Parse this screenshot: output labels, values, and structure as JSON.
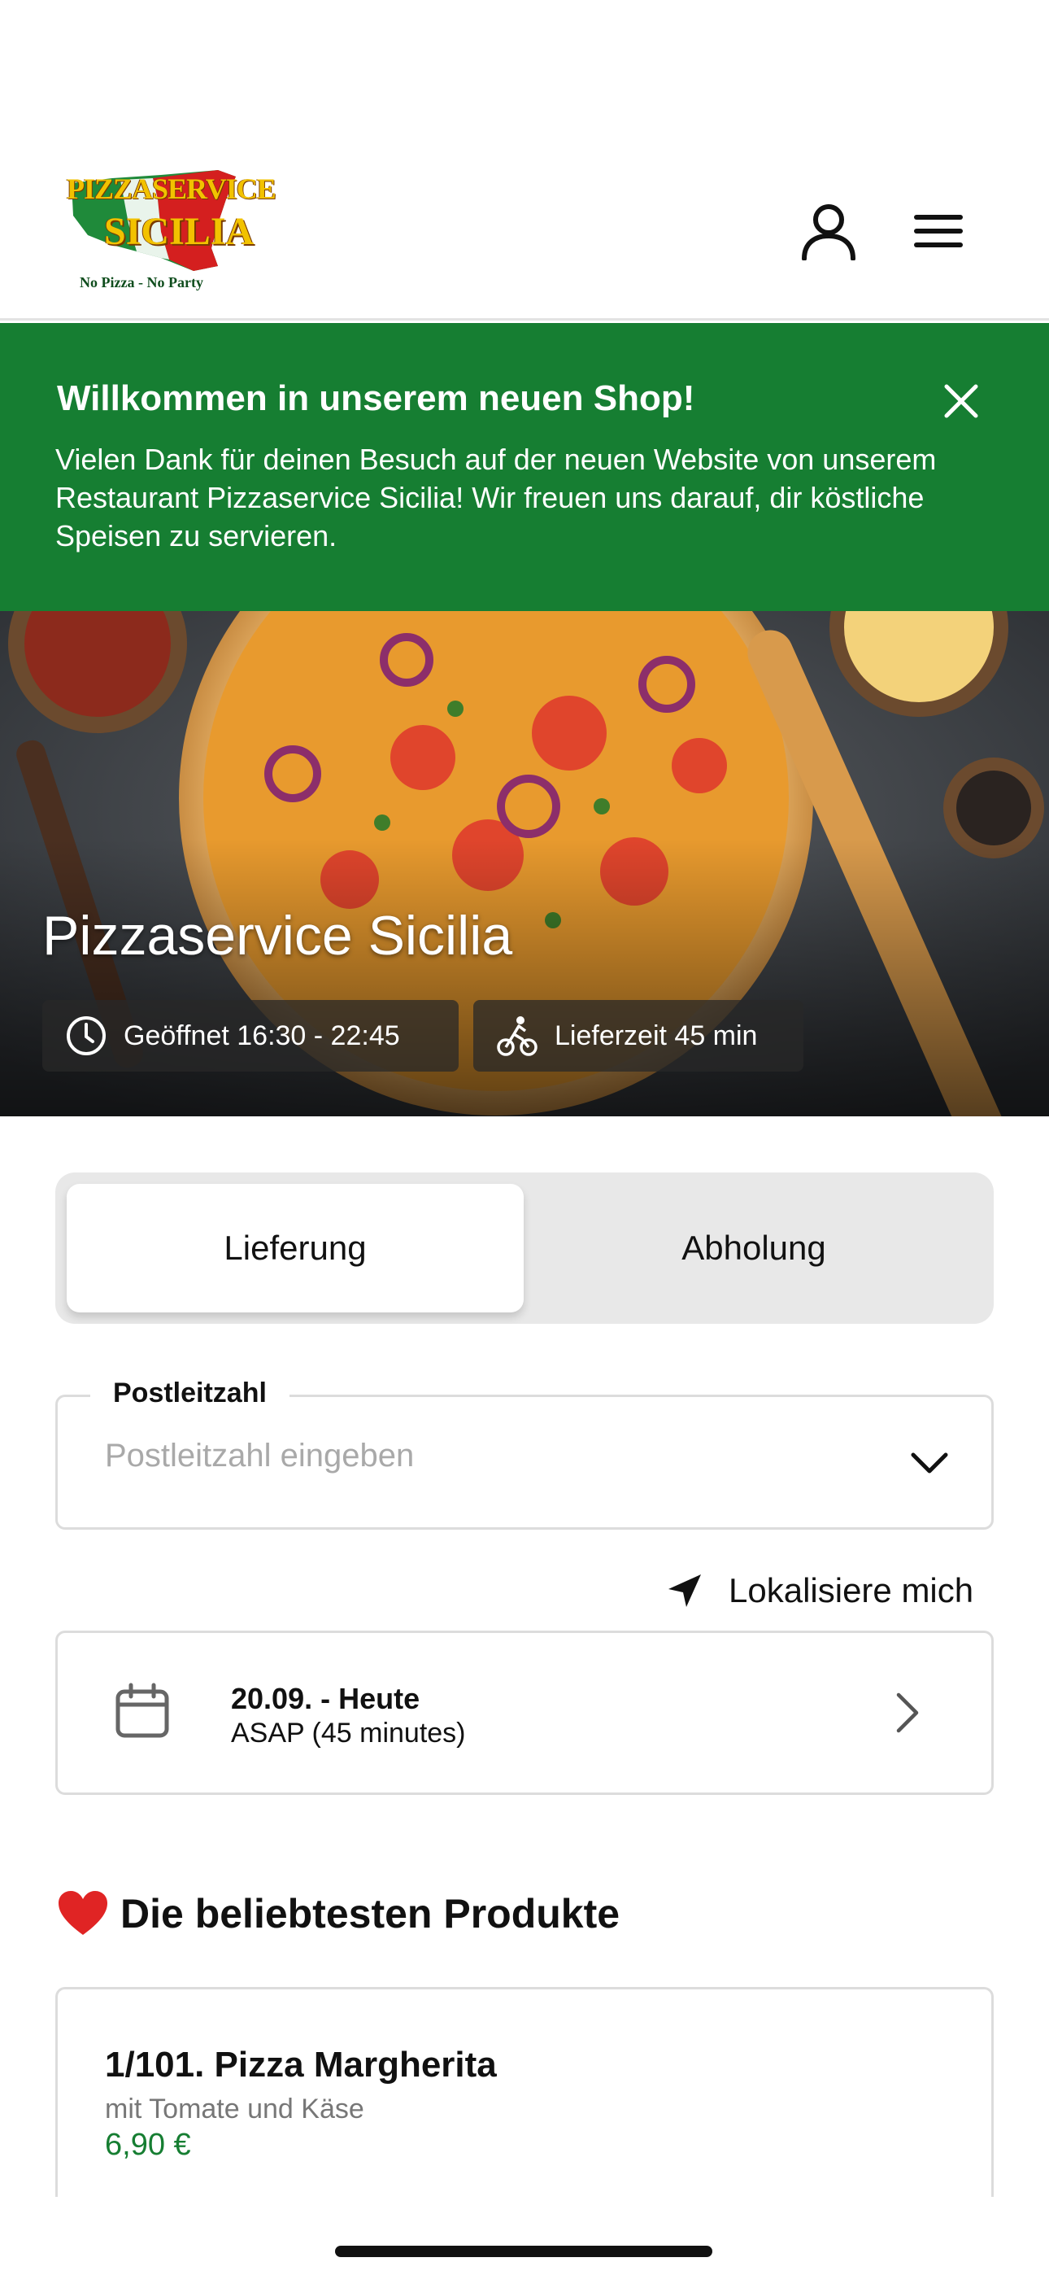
{
  "header": {
    "logo": {
      "line1": "PIZZASERVICE",
      "line2": "SICILIA",
      "tagline": "No Pizza - No Party",
      "colors": {
        "map_green": "#1f8a3a",
        "map_red": "#d41f1f",
        "text_yellow": "#f2c200"
      }
    },
    "icons": {
      "user": "user-icon",
      "menu": "hamburger-menu-icon"
    }
  },
  "banner": {
    "title": "Willkommen in unserem neuen Shop!",
    "text": "Vielen Dank für deinen Besuch auf der neuen Website von unserem Restaurant Pizzaservice Sicilia! Wir freuen uns darauf, dir köstliche Speisen zu servieren.",
    "close_icon": "close-icon",
    "background_color": "#167e32"
  },
  "hero": {
    "title": "Pizzaservice Sicilia",
    "opening_hours": "Geöffnet 16:30 - 22:45",
    "delivery_time": "Lieferzeit 45 min",
    "icons": {
      "clock": "clock-icon",
      "delivery": "bicycle-courier-icon"
    }
  },
  "order_mode": {
    "options": [
      "Lieferung",
      "Abholung"
    ],
    "selected": "Lieferung"
  },
  "postal_code": {
    "label": "Postleitzahl",
    "placeholder": "Postleitzahl eingeben",
    "value": ""
  },
  "locate": {
    "label": "Lokalisiere mich",
    "icon": "location-arrow-icon"
  },
  "schedule": {
    "date": "20.09. - Heute",
    "time": "ASAP (45 minutes)",
    "icon": "calendar-icon"
  },
  "popular": {
    "title": "Die beliebtesten Produkte",
    "icon": "heart-icon",
    "products": [
      {
        "name": "1/101. Pizza Margherita",
        "description": "mit Tomate und Käse",
        "price": "6,90 €"
      }
    ]
  },
  "colors": {
    "accent_green": "#167e32",
    "border": "#dcdcdc",
    "toggle_bg": "#e8e8e8"
  }
}
